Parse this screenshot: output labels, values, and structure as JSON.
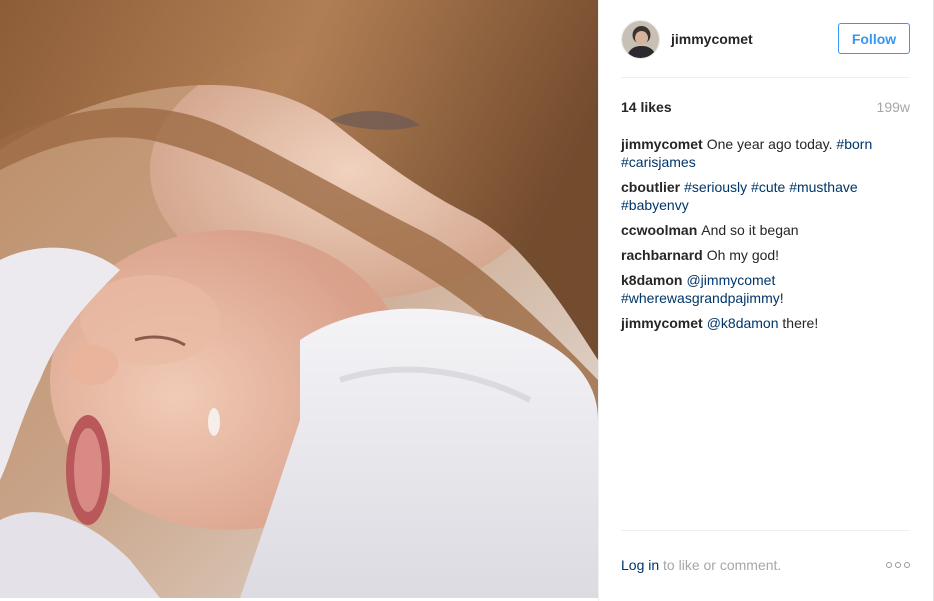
{
  "header": {
    "username": "jimmycomet",
    "follow_label": "Follow"
  },
  "post": {
    "likes": "14 likes",
    "age": "199w"
  },
  "comments": [
    {
      "author": "jimmycomet",
      "parts": [
        {
          "t": "One year ago today. "
        },
        {
          "t": "#born",
          "tag": true
        },
        {
          "t": " "
        },
        {
          "t": "#carisjames",
          "tag": true
        }
      ]
    },
    {
      "author": "cboutlier",
      "parts": [
        {
          "t": "#seriously",
          "tag": true
        },
        {
          "t": " "
        },
        {
          "t": "#cute",
          "tag": true
        },
        {
          "t": " "
        },
        {
          "t": "#musthave",
          "tag": true
        },
        {
          "t": " "
        },
        {
          "t": "#babyenvy",
          "tag": true
        }
      ]
    },
    {
      "author": "ccwoolman",
      "parts": [
        {
          "t": "And so it began"
        }
      ]
    },
    {
      "author": "rachbarnard",
      "parts": [
        {
          "t": "Oh my god!"
        }
      ]
    },
    {
      "author": "k8damon",
      "parts": [
        {
          "t": "@jimmycomet",
          "tag": true
        },
        {
          "t": " "
        },
        {
          "t": "#wherewasgrandpajimmy",
          "tag": true
        },
        {
          "t": "!"
        }
      ]
    },
    {
      "author": "jimmycomet",
      "parts": [
        {
          "t": "@k8damon",
          "tag": true
        },
        {
          "t": " there!"
        }
      ]
    }
  ],
  "footer": {
    "login_link": "Log in",
    "login_rest": " to like or comment."
  },
  "icons": {
    "avatar": "profile-photo",
    "more": "more-options-icon"
  },
  "colors": {
    "link": "#003569",
    "follow": "#3897f0",
    "muted": "#a5a7aa"
  }
}
